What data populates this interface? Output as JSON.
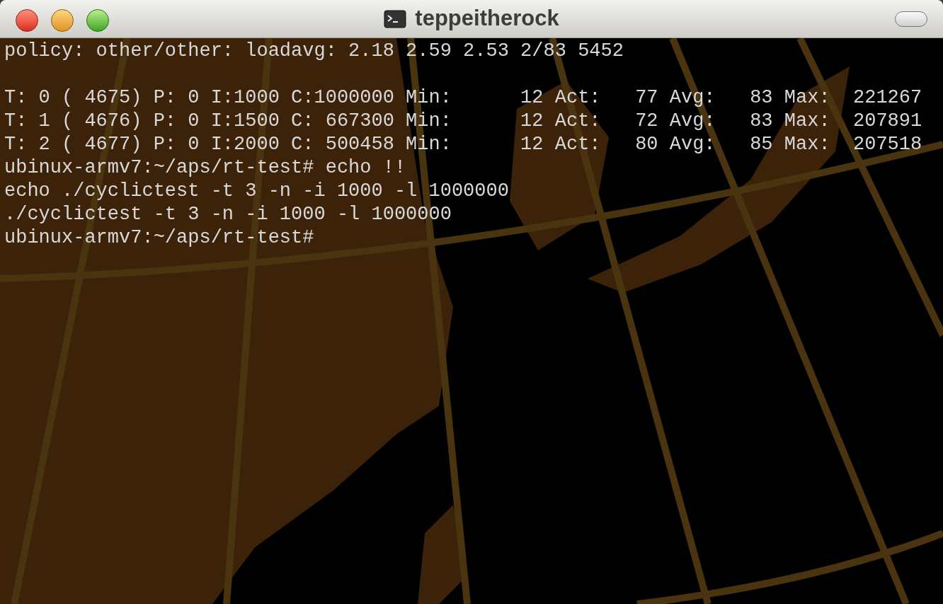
{
  "window": {
    "title": "teppeitherock"
  },
  "terminal": {
    "blocks": [
      [
        "policy: other/other: loadavg: 2.18 2.59 2.53 2/83 5452"
      ],
      [
        "T: 0 ( 4675) P: 0 I:1000 C:1000000 Min:      12 Act:   77 Avg:   83 Max:  221267",
        "T: 1 ( 4676) P: 0 I:1500 C: 667300 Min:      12 Act:   72 Avg:   83 Max:  207891",
        "T: 2 ( 4677) P: 0 I:2000 C: 500458 Min:      12 Act:   80 Avg:   85 Max:  207518",
        "ubinux-armv7:~/aps/rt-test# echo !!",
        "echo ./cyclictest -t 3 -n -i 1000 -l 1000000",
        "./cyclictest -t 3 -n -i 1000 -l 1000000",
        "ubinux-armv7:~/aps/rt-test#"
      ]
    ]
  }
}
